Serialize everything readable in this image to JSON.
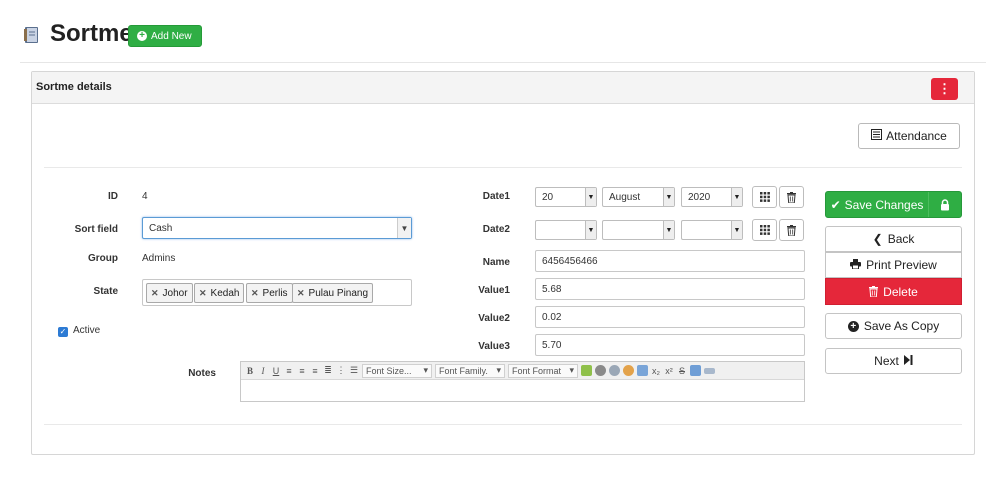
{
  "header": {
    "title": "Sortme",
    "add_new_label": "Add New"
  },
  "panel": {
    "title": "Sortme details",
    "menu_glyph": "⋮",
    "attendance_label": "Attendance"
  },
  "form": {
    "id": {
      "label": "ID",
      "value": "4"
    },
    "sort_field": {
      "label": "Sort field",
      "value": "Cash"
    },
    "group": {
      "label": "Group",
      "value": "Admins"
    },
    "state": {
      "label": "State",
      "tags": [
        "Johor",
        "Kedah",
        "Perlis",
        "Pulau Pinang"
      ]
    },
    "active": {
      "label": "Active",
      "checked": true
    },
    "notes": {
      "label": "Notes"
    },
    "date1": {
      "label": "Date1",
      "day": "20",
      "month": "August",
      "year": "2020"
    },
    "date2": {
      "label": "Date2",
      "day": "",
      "month": "",
      "year": ""
    },
    "name": {
      "label": "Name",
      "value": "6456456466"
    },
    "value1": {
      "label": "Value1",
      "value": "5.68"
    },
    "value2": {
      "label": "Value2",
      "value": "0.02"
    },
    "value3": {
      "label": "Value3",
      "value": "5.70"
    }
  },
  "editor_toolbar": {
    "font_size": "Font Size...",
    "font_family": "Font Family.",
    "font_format": "Font Format"
  },
  "actions": {
    "save": "Save Changes",
    "back": "Back",
    "print_preview": "Print Preview",
    "delete": "Delete",
    "save_as_copy": "Save As Copy",
    "next": "Next"
  },
  "colors": {
    "success": "#2fae44",
    "danger": "#e5273a",
    "focus": "#5b9bd5"
  }
}
